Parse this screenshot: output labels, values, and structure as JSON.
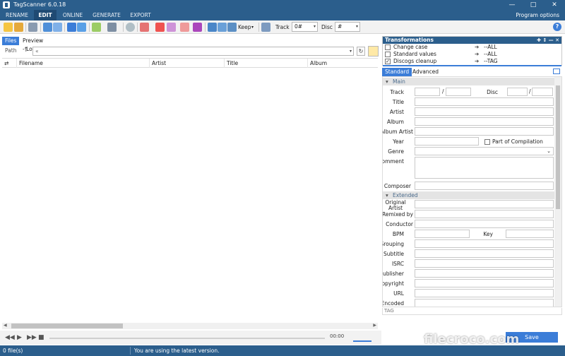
{
  "window": {
    "title": "TagScanner 6.0.18",
    "controls": [
      "—",
      "□",
      "✕"
    ]
  },
  "menu": {
    "items": [
      "RENAME",
      "EDIT",
      "ONLINE",
      "GENERATE",
      "EXPORT"
    ],
    "active": "EDIT",
    "program_options": "Program options"
  },
  "toolbar": {
    "keep_label": "Keep",
    "track_label": "Track",
    "track_value": "0#",
    "disc_label": "Disc",
    "disc_value": "#",
    "help": "?"
  },
  "left_panel": {
    "tabs": [
      "Files",
      "Preview - Log"
    ],
    "path_label": "Path",
    "path_value": "«",
    "columns": [
      "Filename",
      "Artist",
      "Title",
      "Album"
    ]
  },
  "player": {
    "time": "00:00"
  },
  "status": {
    "file_count": "0 file(s)",
    "message": "You are using the latest version."
  },
  "transformations": {
    "title": "Transformations",
    "header_icons": "✚  ↕ — ✕",
    "rows": [
      {
        "name": "Change case",
        "target": "--ALL",
        "checked": false
      },
      {
        "name": "Standard values",
        "target": "--ALL",
        "checked": false
      },
      {
        "name": "Discogs cleanup",
        "target": "--TAG",
        "checked": true
      }
    ]
  },
  "right_tabs": [
    "Standard",
    "Advanced"
  ],
  "tag_editor": {
    "section_main": "Main",
    "section_extended": "Extended",
    "track": "Track",
    "disc": "Disc",
    "slash": "/",
    "title": "Title",
    "artist": "Artist",
    "album": "Album",
    "album_artist": "Album Artist",
    "year": "Year",
    "part_of_compilation": "Part of Compilation",
    "genre": "Genre",
    "comment": "Comment",
    "composer": "Composer",
    "original_artist": "Original Artist",
    "remixed_by": "Remixed by",
    "conductor": "Conductor",
    "bpm": "BPM",
    "key": "Key",
    "grouping": "Grouping",
    "subtitle": "Subtitle",
    "isrc": "ISRC",
    "publisher": "Publisher",
    "copyright": "Copyright",
    "url": "URL",
    "encoded_by": "Encoded by",
    "footer": "TAG"
  },
  "save_label": "Save",
  "watermark": "filecroco.com"
}
